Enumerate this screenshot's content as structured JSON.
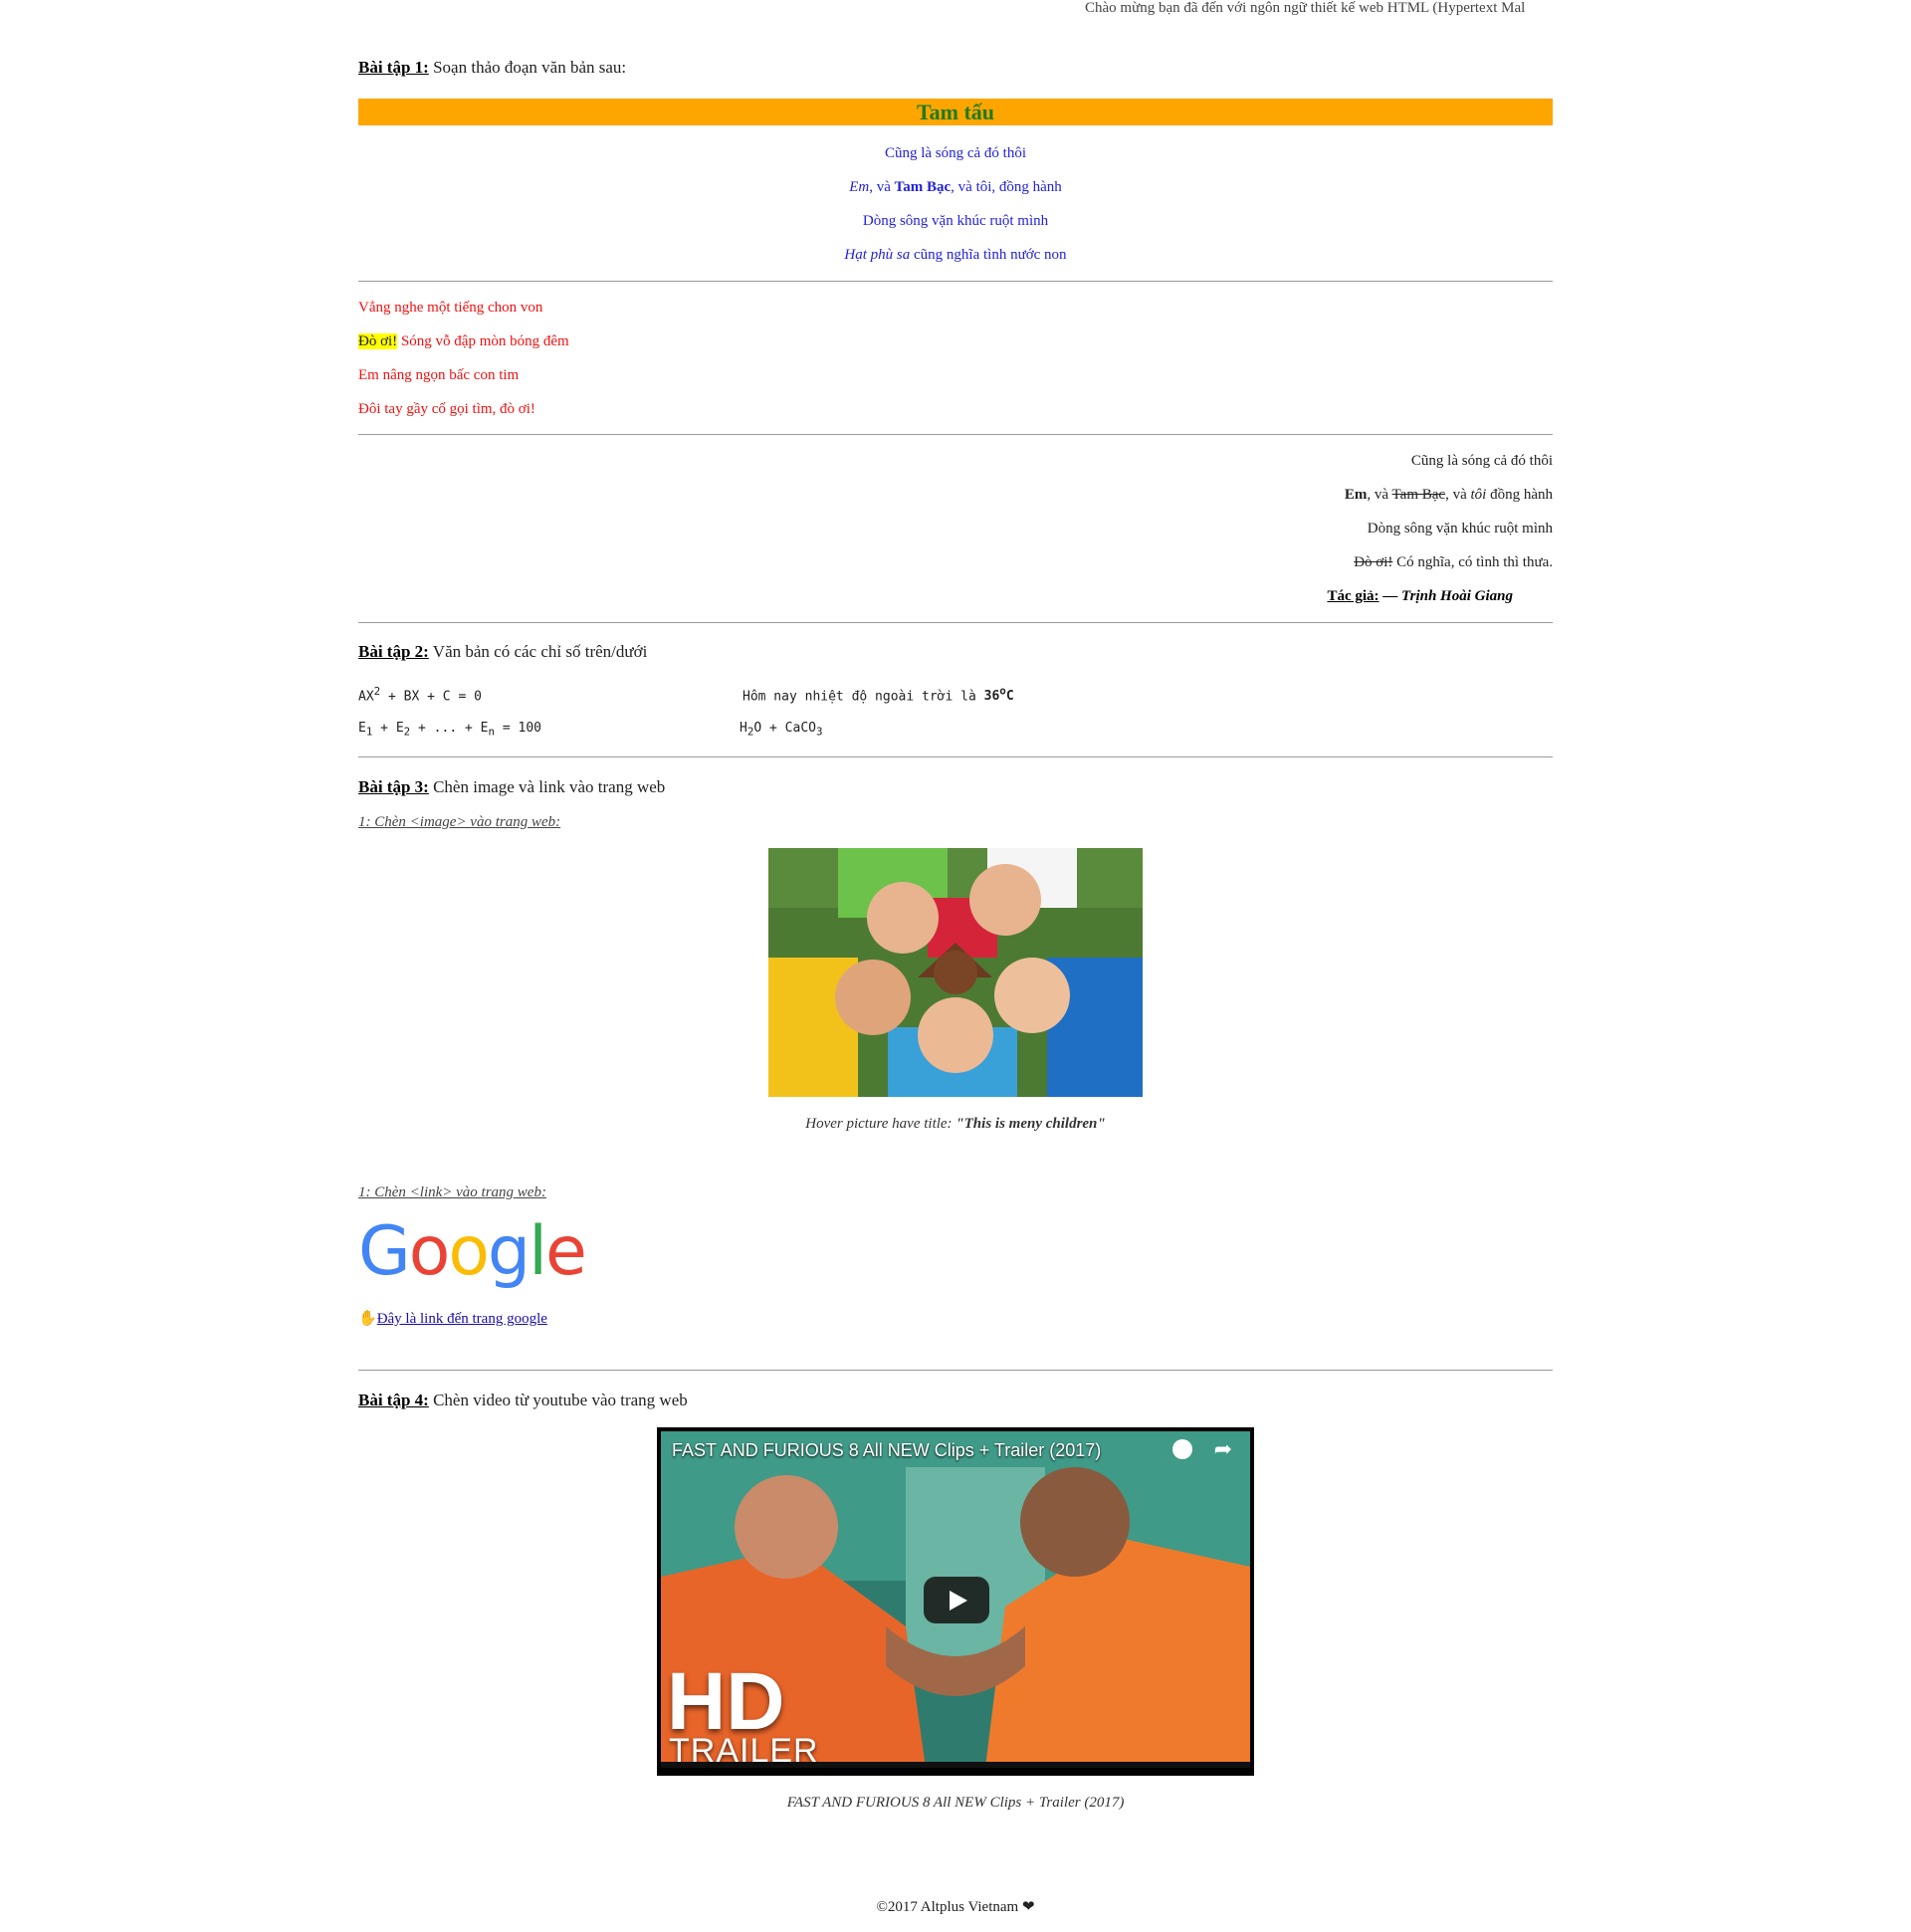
{
  "marquee": "Chào mừng bạn đã đến với ngôn ngữ thiết kế web HTML (Hypertext Mal",
  "ex1": {
    "label": "Bài tập 1:",
    "text": " Soạn thảo đoạn văn bản sau:",
    "banner": "Tam tấu",
    "poem1": {
      "l1": "Cũng là sóng cả đó thôi",
      "l2_em": "Em",
      "l2_a": ", và ",
      "l2_b": "Tam Bạc",
      "l2_c": ", và tôi, đồng hành",
      "l3": "Dòng sông vặn khúc ruột mình",
      "l4_em": "Hạt phù sa",
      "l4_rest": " cũng nghĩa tình nước non"
    },
    "poem2": {
      "l1": "Vẳng nghe một tiếng chon von",
      "l2_hl": "Đò ơi!",
      "l2_rest": " Sóng vỗ đập mòn bóng đêm",
      "l3": "Em nâng ngọn bấc con tim",
      "l4": "Đôi tay gầy cố gọi tìm, đò ơi!"
    },
    "poem3": {
      "l1": "Cũng là sóng cả đó thôi",
      "l2_b": "Em",
      "l2_a": ", và ",
      "l2_del": "Tam Bạc",
      "l2_c": ", và ",
      "l2_em": "tôi",
      "l2_d": " đồng hành",
      "l3": "Dòng sông vặn khúc ruột mình",
      "l4_del": "Đò ơi!",
      "l4_rest": " Có nghĩa, có tình thì thưa.",
      "author_label": "Tác giả:",
      "author_dash": " — ",
      "author": "Trịnh Hoài Giang"
    }
  },
  "ex2": {
    "label": "Bài tập 2:",
    "text": " Văn bản có các chỉ số trên/dưới",
    "f1_a": "AX",
    "f1_sup": "2",
    "f1_b": " + BX + C = 0",
    "f2_a": "Hôm nay nhiệt độ ngoài trời là ",
    "f2_b": "36",
    "f2_sup": "o",
    "f2_c": "C",
    "f3_e": "E",
    "f3_1": "1",
    "f3_plus": " + ",
    "f3_2": "2",
    "f3_dots": " + ... + ",
    "f3_n": "n",
    "f3_end": " = 100",
    "f4_h": "H",
    "f4_2": "2",
    "f4_o": "O + CaCO",
    "f4_3": "3"
  },
  "ex3": {
    "label": "Bài tập 3:",
    "text": " Chèn image và link vào trang web",
    "sub1": "1: Chèn <image> vào trang web:",
    "caption_a": "Hover picture have title: ",
    "caption_b": "\"This is meny children\"",
    "sub2": "1: Chèn <link> vào trang web:",
    "google": [
      "G",
      "o",
      "o",
      "g",
      "l",
      "e"
    ],
    "link_icon": "✋",
    "link_text": "Đây là link đến trang google"
  },
  "ex4": {
    "label": "Bài tập 4:",
    "text": " Chèn video từ youtube vào trang web",
    "video_title": "FAST AND FURIOUS 8 All NEW Clips + Trailer (2017)",
    "hd": "HD",
    "trailer": "TRAILER",
    "caption": "FAST AND FURIOUS 8 All NEW Clips + Trailer (2017)"
  },
  "footer": {
    "text": "©2017 Altplus Vietnam ",
    "heart": "❤"
  },
  "colors": {
    "banner_bg": "#ffa500",
    "banner_text": "#1e7b1e",
    "poem1": "#2222dd",
    "poem2": "#ee1111",
    "highlight": "#ffff00"
  }
}
